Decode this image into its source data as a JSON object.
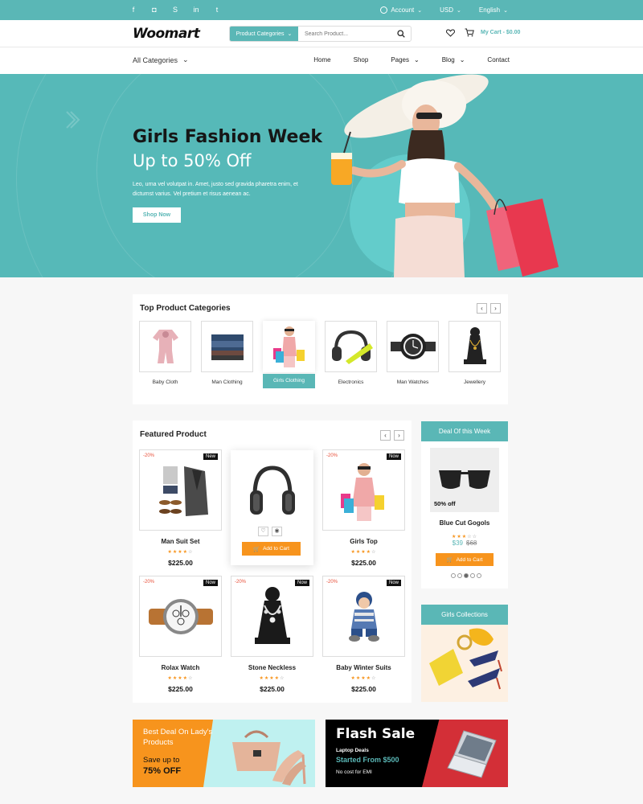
{
  "topbar": {
    "account": "Account",
    "currency": "USD",
    "language": "English"
  },
  "header": {
    "logo": "Woomart",
    "category_button": "Product Categories",
    "search_placeholder": "Search Product...",
    "cart": "My Cart - $0.00"
  },
  "nav": {
    "all_categories": "All Categories",
    "items": [
      "Home",
      "Shop",
      "Pages",
      "Blog",
      "Contact"
    ]
  },
  "hero": {
    "title": "Girls Fashion Week",
    "subtitle": "Up to 50% Off",
    "text": "Leo, urna vel volutpat in. Amet, justo sed gravida pharetra enim, et dictumst varius. Vel pretium et risus aenean ac.",
    "button": "Shop Now"
  },
  "categories": {
    "title": "Top Product Categories",
    "items": [
      "Baby Cloth",
      "Man Clothing",
      "Girls Clothing",
      "Electronics",
      "Man Watches",
      "Jewellery"
    ]
  },
  "featured": {
    "title": "Featured Product",
    "products": [
      {
        "name": "Man Suit Set",
        "price": "$225.00",
        "discount": "-20%",
        "badge": "New",
        "rating": 4
      },
      {
        "name": "",
        "price": "",
        "discount": "",
        "badge": "",
        "rating": 0
      },
      {
        "name": "Girls Top",
        "price": "$225.00",
        "discount": "-20%",
        "badge": "Now",
        "rating": 4
      },
      {
        "name": "Rolax Watch",
        "price": "$225.00",
        "discount": "-20%",
        "badge": "Now",
        "rating": 4
      },
      {
        "name": "Stone Neckless",
        "price": "$225.00",
        "discount": "-20%",
        "badge": "Now",
        "rating": 4
      },
      {
        "name": "Baby Winter Suits",
        "price": "$225.00",
        "discount": "-20%",
        "badge": "Now",
        "rating": 4
      }
    ],
    "add_to_cart": "Add to Cart"
  },
  "deal": {
    "title": "Deal Of this Week",
    "badge": "50% off",
    "name": "Blue Cut Gogols",
    "price": "$39",
    "old_price": "$68",
    "rating": 3,
    "add_to_cart": "Add to Cart"
  },
  "girls_collections": {
    "title": "Girls Collections"
  },
  "banner_left": {
    "line1": "Best Deal On Lady's Products",
    "line2": "Save up to",
    "line3": "75% OFF"
  },
  "banner_right": {
    "title": "Flash Sale",
    "line1": "Laptop Deals",
    "line2": "Started From $500",
    "line3": "No cost for EMI"
  },
  "colors": {
    "accent": "#5ab7b6",
    "orange": "#f7941d",
    "red": "#d32f37"
  }
}
